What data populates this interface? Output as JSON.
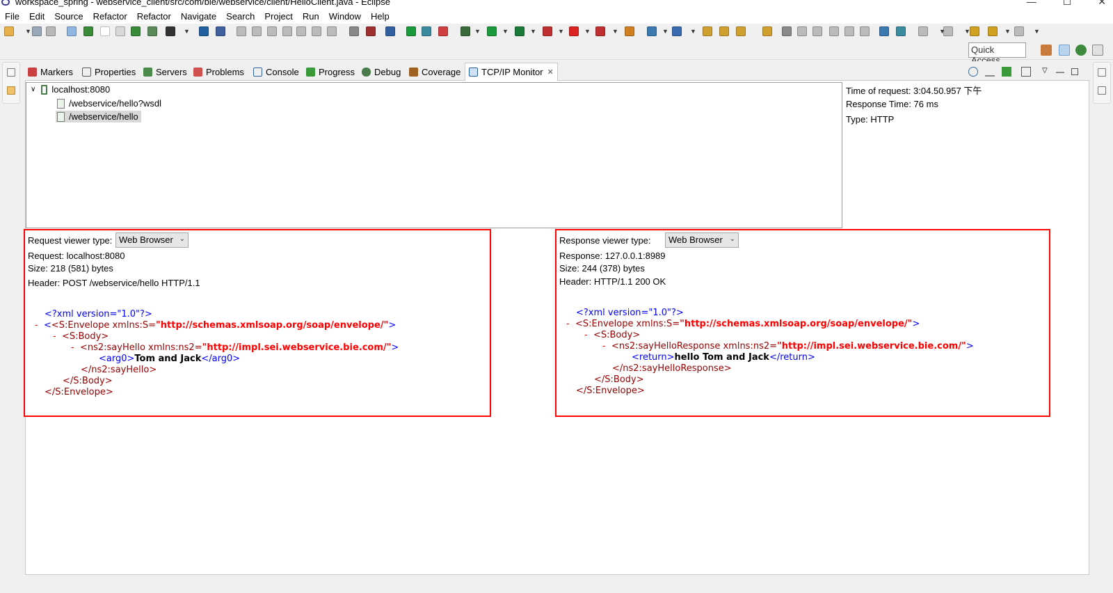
{
  "window": {
    "title": "workspace_spring - webservice_client/src/com/bie/webservice/client/HelloClient.java - Eclipse",
    "controls": [
      "—",
      "☐",
      "✕"
    ]
  },
  "menu": [
    "File",
    "Edit",
    "Source",
    "Refactor",
    "Refactor",
    "Navigate",
    "Search",
    "Project",
    "Run",
    "Window",
    "Help"
  ],
  "quick_access": "Quick Access",
  "tabs": [
    {
      "label": "Markers",
      "icon": "markers-icon"
    },
    {
      "label": "Properties",
      "icon": "properties-icon"
    },
    {
      "label": "Servers",
      "icon": "servers-icon"
    },
    {
      "label": "Problems",
      "icon": "problems-icon"
    },
    {
      "label": "Console",
      "icon": "console-icon"
    },
    {
      "label": "Progress",
      "icon": "progress-icon"
    },
    {
      "label": "Debug",
      "icon": "debug-icon"
    },
    {
      "label": "Coverage",
      "icon": "coverage-icon"
    },
    {
      "label": "TCP/IP Monitor",
      "icon": "tcpip-monitor-icon"
    }
  ],
  "tree": {
    "root": "localhost:8080",
    "children": [
      "/webservice/hello?wsdl",
      "/webservice/hello"
    ]
  },
  "info": {
    "time_of_request": "Time of request: 3:04.50.957 下午",
    "response_time": "Response Time: 76 ms",
    "type": "Type: HTTP"
  },
  "request": {
    "viewer_label": "Request viewer type:",
    "viewer_value": "Web Browser",
    "request": "Request: localhost:8080",
    "size": "Size: 218 (581) bytes",
    "header": "Header: POST /webservice/hello HTTP/1.1"
  },
  "response": {
    "viewer_label": "Response viewer type:",
    "viewer_value": "Web Browser",
    "response": "Response: 127.0.0.1:8989",
    "size": "Size: 244 (378) bytes",
    "header": "Header: HTTP/1.1 200 OK"
  },
  "xml": {
    "decl": "<?xml version=\"1.0\"?>",
    "envelope_open": "<S:Envelope xmlns:S=",
    "envelope_ns": "\"http://schemas.xmlsoap.org/soap/envelope/\"",
    "envelope_close_tag": ">",
    "body_open": "<S:Body>",
    "sayhello_open": "<ns2:sayHello xmlns:ns2=",
    "sayhelloresp_open": "<ns2:sayHelloResponse xmlns:ns2=",
    "impl_ns": "\"http://impl.sei.webservice.bie.com/\"",
    "arg0_open": "<arg0>",
    "arg0_val": "Tom and Jack",
    "arg0_close": "</arg0>",
    "return_open": "<return>",
    "return_val": "hello Tom and Jack",
    "return_close": "</return>",
    "sayhello_close": "</ns2:sayHello>",
    "sayhelloresp_close": "</ns2:sayHelloResponse>",
    "body_close": "</S:Body>",
    "envelope_close": "</S:Envelope>",
    "dash": "-"
  }
}
